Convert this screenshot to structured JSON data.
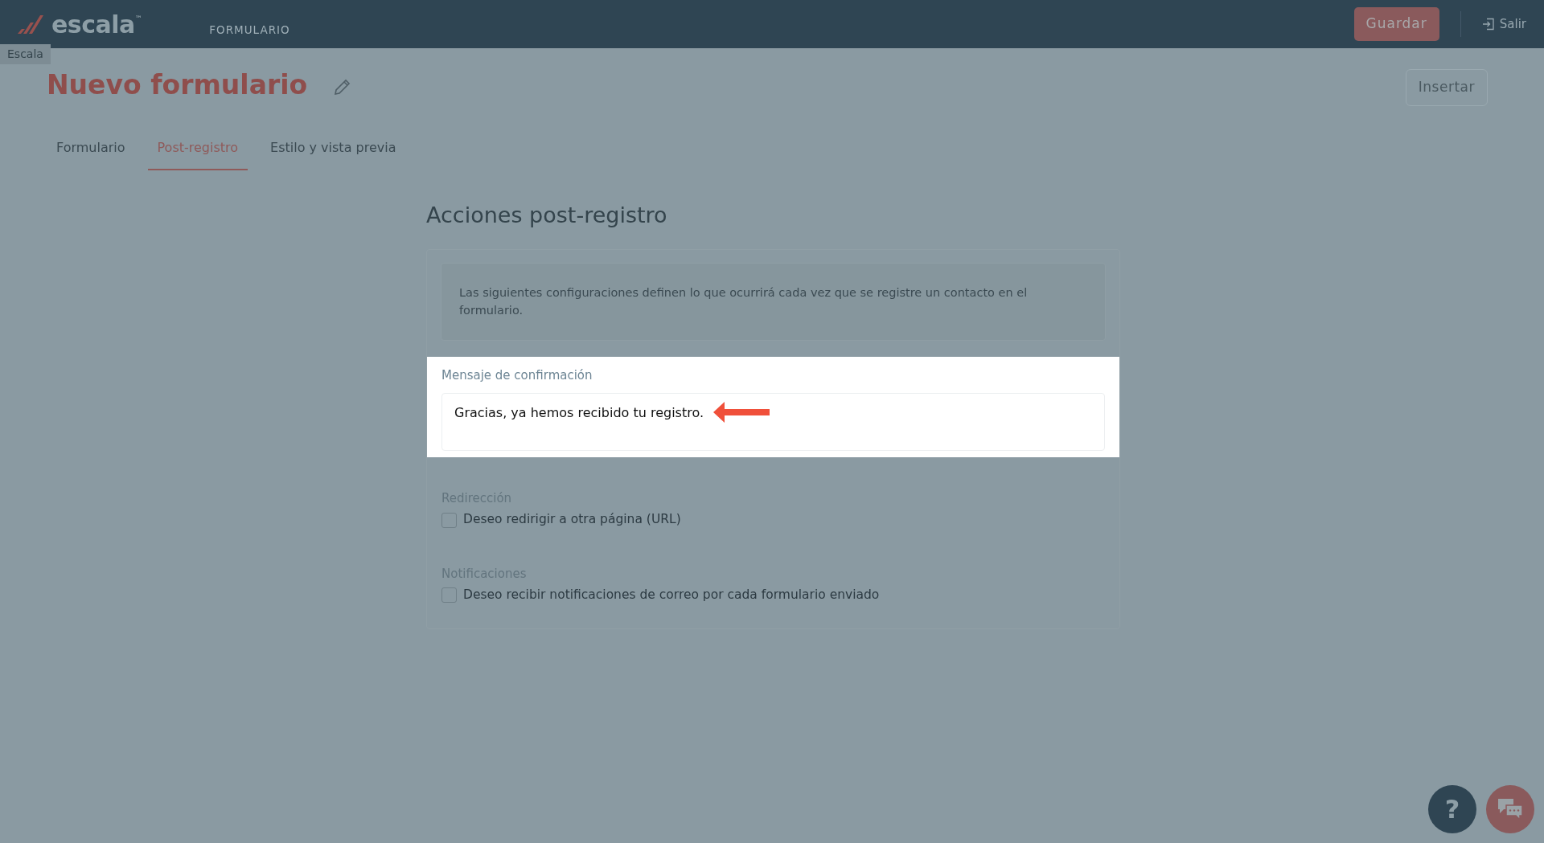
{
  "navbar": {
    "logo_text": "escala$^{™}$",
    "section": "FORMULARIO",
    "save_button": "Guardar",
    "exit_link": "Salir",
    "tooltip": "Escala"
  },
  "page": {
    "title": "Nuevo formulario",
    "insert_button": "Insertar"
  },
  "tabs": [
    {
      "label": "Formulario",
      "selected": false
    },
    {
      "label": "Post-registro",
      "selected": true
    },
    {
      "label": "Estilo y vista previa",
      "selected": false
    }
  ],
  "content": {
    "heading": "Acciones post-registro",
    "info": "Las siguientes configuraciones definen lo que ocurrirá cada vez que se registre un contacto en el formulario.",
    "confirmation": {
      "label": "Mensaje de confirmación",
      "value": "Gracias, ya hemos recibido tu registro.",
      "highlighted": true
    },
    "sections": [
      {
        "label": "Redirección",
        "option": "Deseo redirigir a otra página (URL)",
        "checked": false
      },
      {
        "label": "Notificaciones",
        "option": "Deseo recibir notificaciones de correo por cada formulario enviado",
        "checked": false
      }
    ]
  },
  "floating_buttons": [
    {
      "kind": "help",
      "label": "?"
    },
    {
      "kind": "chat"
    }
  ]
}
